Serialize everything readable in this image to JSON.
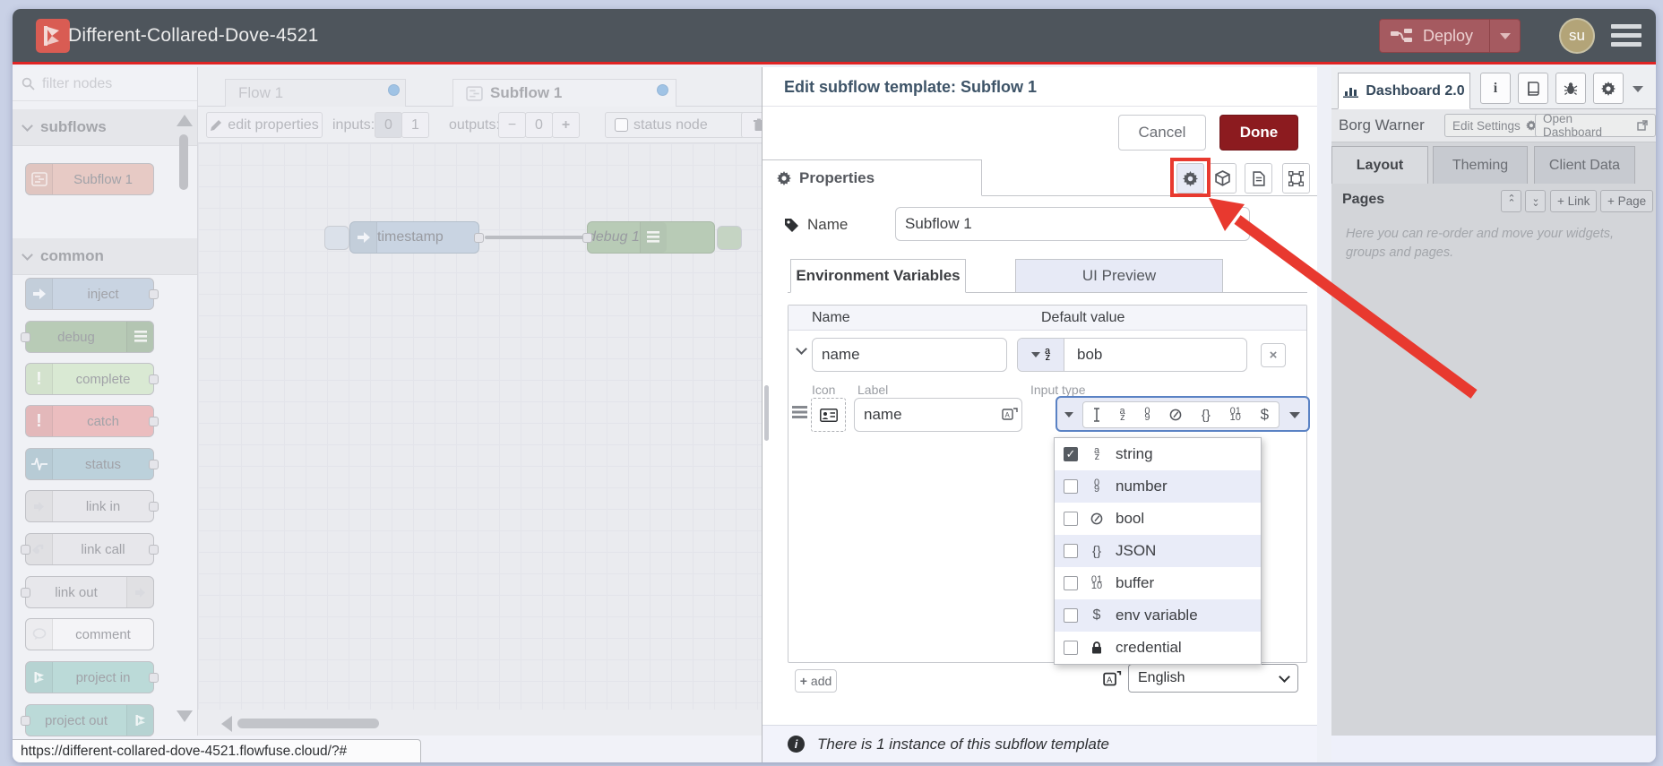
{
  "header": {
    "title": "Different-Collared-Dove-4521",
    "deploy_label": "Deploy",
    "avatar_initials": "su"
  },
  "palette": {
    "filter_placeholder": "filter nodes",
    "sections": [
      {
        "label": "subflows",
        "items": [
          {
            "label": "Subflow 1"
          }
        ]
      },
      {
        "label": "common",
        "items": [
          {
            "label": "inject"
          },
          {
            "label": "debug"
          },
          {
            "label": "complete"
          },
          {
            "label": "catch"
          },
          {
            "label": "status"
          },
          {
            "label": "link in"
          },
          {
            "label": "link call"
          },
          {
            "label": "link out"
          },
          {
            "label": "comment"
          },
          {
            "label": "project in"
          },
          {
            "label": "project out"
          }
        ]
      }
    ]
  },
  "workspace": {
    "tabs": [
      {
        "label": "Flow 1"
      },
      {
        "label": "Subflow 1"
      }
    ],
    "toolbar": {
      "edit_properties": "edit properties",
      "inputs_label": "inputs:",
      "inputs_zero": "0",
      "inputs_one": "1",
      "outputs_label": "outputs:",
      "outputs_minus": "−",
      "outputs_value": "0",
      "outputs_plus": "+",
      "status_node_label": "status node"
    },
    "nodes": [
      {
        "label": "timestamp"
      },
      {
        "label": "debug 1"
      }
    ],
    "url_status": "https://different-collared-dove-4521.flowfuse.cloud/?#"
  },
  "dialog": {
    "title": "Edit subflow template: Subflow 1",
    "cancel_label": "Cancel",
    "done_label": "Done",
    "properties_tab": "Properties",
    "name_label": "Name",
    "name_value": "Subflow 1",
    "env_tab": "Environment Variables",
    "ui_tab": "UI Preview",
    "table": {
      "name_header": "Name",
      "default_header": "Default value",
      "row_name": "name",
      "row_value": "bob"
    },
    "detail": {
      "icon_label": "Icon",
      "label_label": "Label",
      "input_type_label": "Input type",
      "label_value": "name"
    },
    "type_menu": {
      "options": [
        {
          "label": "string",
          "checked": true
        },
        {
          "label": "number",
          "checked": false
        },
        {
          "label": "bool",
          "checked": false
        },
        {
          "label": "JSON",
          "checked": false
        },
        {
          "label": "buffer",
          "checked": false
        },
        {
          "label": "env variable",
          "checked": false
        },
        {
          "label": "credential",
          "checked": false
        }
      ]
    },
    "add_label": "add",
    "language_value": "English",
    "footer_note": "There is 1 instance of this subflow template"
  },
  "sidebar": {
    "dashboard_tab": "Dashboard 2.0",
    "team_name": "Borg Warner",
    "edit_settings_label": "Edit Settings",
    "open_dashboard_label": "Open Dashboard",
    "tabs": [
      {
        "label": "Layout"
      },
      {
        "label": "Theming"
      },
      {
        "label": "Client Data"
      }
    ],
    "pages_title": "Pages",
    "link_button": "+ Link",
    "page_button": "+ Page",
    "help_text": "Here you can re-order and move your widgets, groups and pages."
  },
  "colors": {
    "annotation_red": "#e8392f",
    "header_bg": "#4e555c",
    "header_accent": "#e02424",
    "deploy_bg": "#a55a60",
    "done_bg": "#8c1b1f",
    "focus_blue": "#5a82c4"
  }
}
